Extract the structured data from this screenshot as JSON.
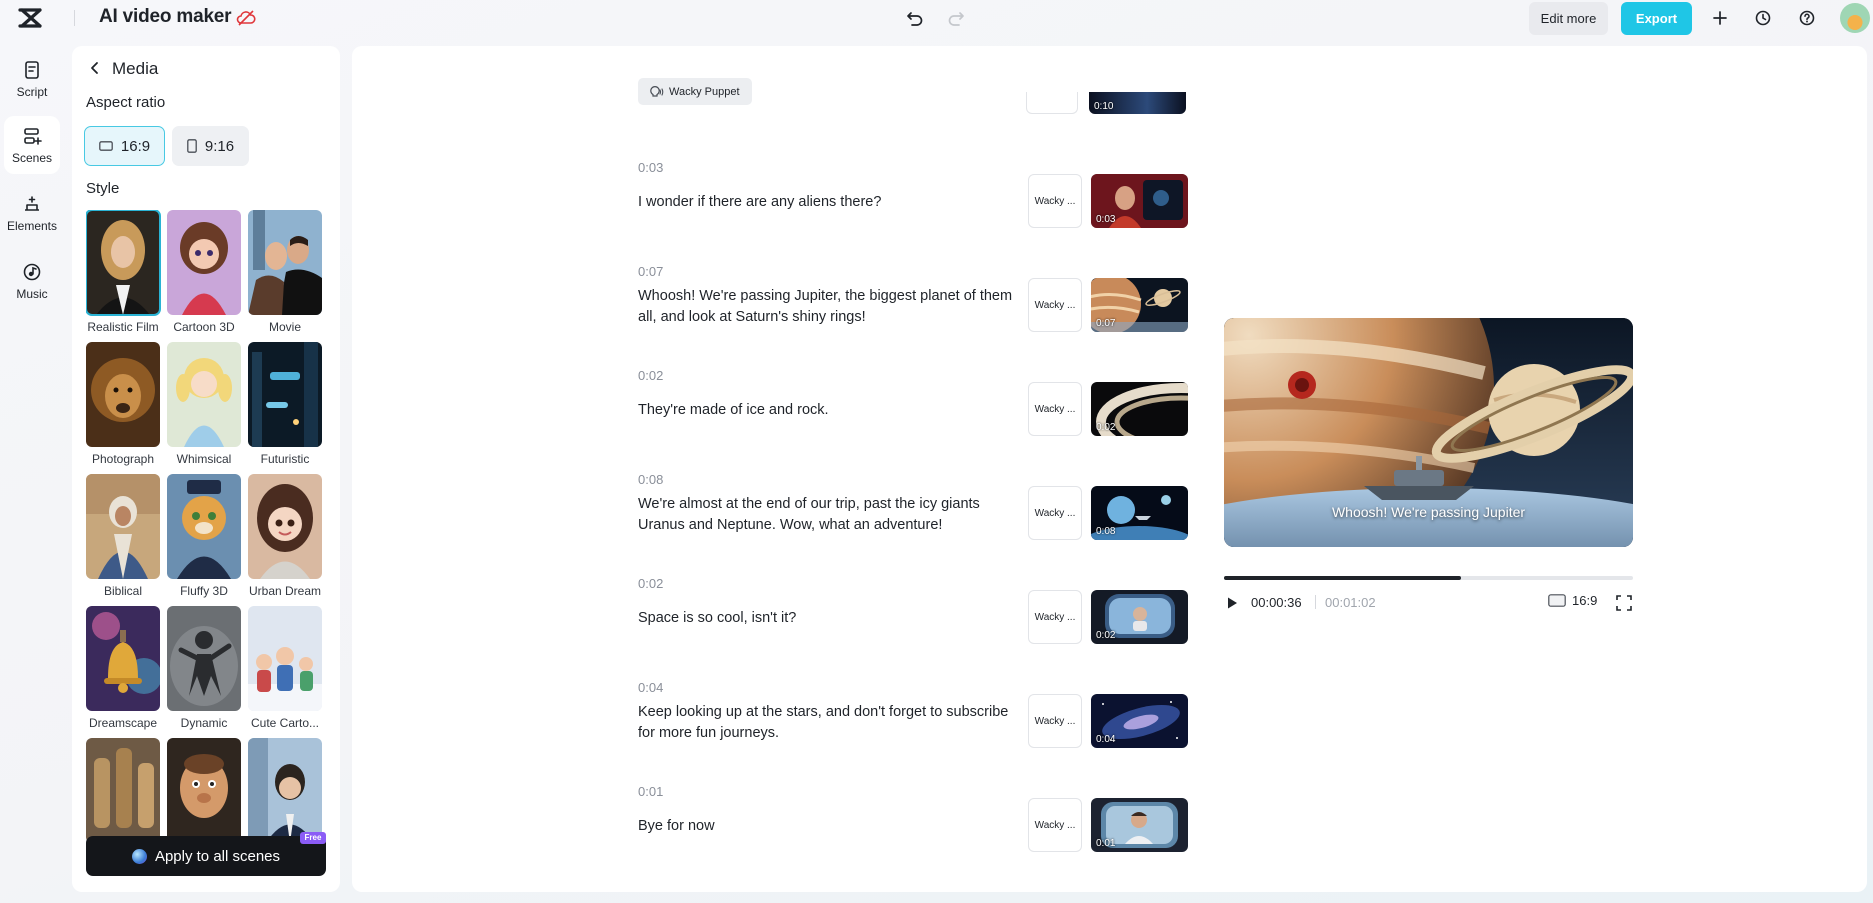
{
  "app": {
    "title": "AI video maker"
  },
  "toolbar": {
    "edit_more_label": "Edit more",
    "export_label": "Export",
    "accent_color": "#1fc6e6"
  },
  "rail": {
    "items": [
      {
        "label": "Script",
        "icon": "script-icon"
      },
      {
        "label": "Scenes",
        "icon": "scenes-icon",
        "active": true
      },
      {
        "label": "Elements",
        "icon": "elements-icon"
      },
      {
        "label": "Music",
        "icon": "music-icon"
      }
    ]
  },
  "panel": {
    "title": "Media",
    "aspect_ratio_label": "Aspect ratio",
    "ratios": [
      {
        "label": "16:9",
        "selected": true
      },
      {
        "label": "9:16",
        "selected": false
      }
    ],
    "style_label": "Style",
    "styles": [
      {
        "name": "Realistic Film",
        "selected": true
      },
      {
        "name": "Cartoon 3D"
      },
      {
        "name": "Movie"
      },
      {
        "name": "Photograph"
      },
      {
        "name": "Whimsical"
      },
      {
        "name": "Futuristic"
      },
      {
        "name": "Biblical"
      },
      {
        "name": "Fluffy 3D"
      },
      {
        "name": "Urban Dream"
      },
      {
        "name": "Dreamscape"
      },
      {
        "name": "Dynamic"
      },
      {
        "name": "Cute Carto..."
      },
      {
        "name": ""
      },
      {
        "name": ""
      },
      {
        "name": ""
      }
    ],
    "apply_label": "Apply to all scenes",
    "free_badge": "Free"
  },
  "script": {
    "voice_chip": "Wacky Puppet",
    "top_partial_text": "",
    "top_partial_time": "0:10",
    "scenes": [
      {
        "time": "0:03",
        "text": "I wonder if there are any aliens there?",
        "voice": "Wacky ...",
        "thumb_time": "0:03"
      },
      {
        "time": "0:07",
        "text": "Whoosh! We're passing Jupiter, the biggest planet of them all, and look at Saturn's shiny rings!",
        "voice": "Wacky ...",
        "thumb_time": "0:07"
      },
      {
        "time": "0:02",
        "text": "They're made of ice and rock.",
        "voice": "Wacky ...",
        "thumb_time": "0:02"
      },
      {
        "time": "0:08",
        "text": "We're almost at the end of our trip, past the icy giants Uranus and Neptune. Wow, what an adventure!",
        "voice": "Wacky ...",
        "thumb_time": "0:08"
      },
      {
        "time": "0:02",
        "text": "Space is so cool, isn't it?",
        "voice": "Wacky ...",
        "thumb_time": "0:02"
      },
      {
        "time": "0:04",
        "text": "Keep looking up at the stars, and don't forget to subscribe for more fun journeys.",
        "voice": "Wacky ...",
        "thumb_time": "0:04"
      },
      {
        "time": "0:01",
        "text": "Bye for now",
        "voice": "Wacky ...",
        "thumb_time": "0:01"
      }
    ]
  },
  "preview": {
    "caption": "Whoosh! We're passing Jupiter",
    "current_time": "00:00:36",
    "total_time": "00:01:02",
    "progress": 0.58,
    "ratio": "16:9"
  }
}
